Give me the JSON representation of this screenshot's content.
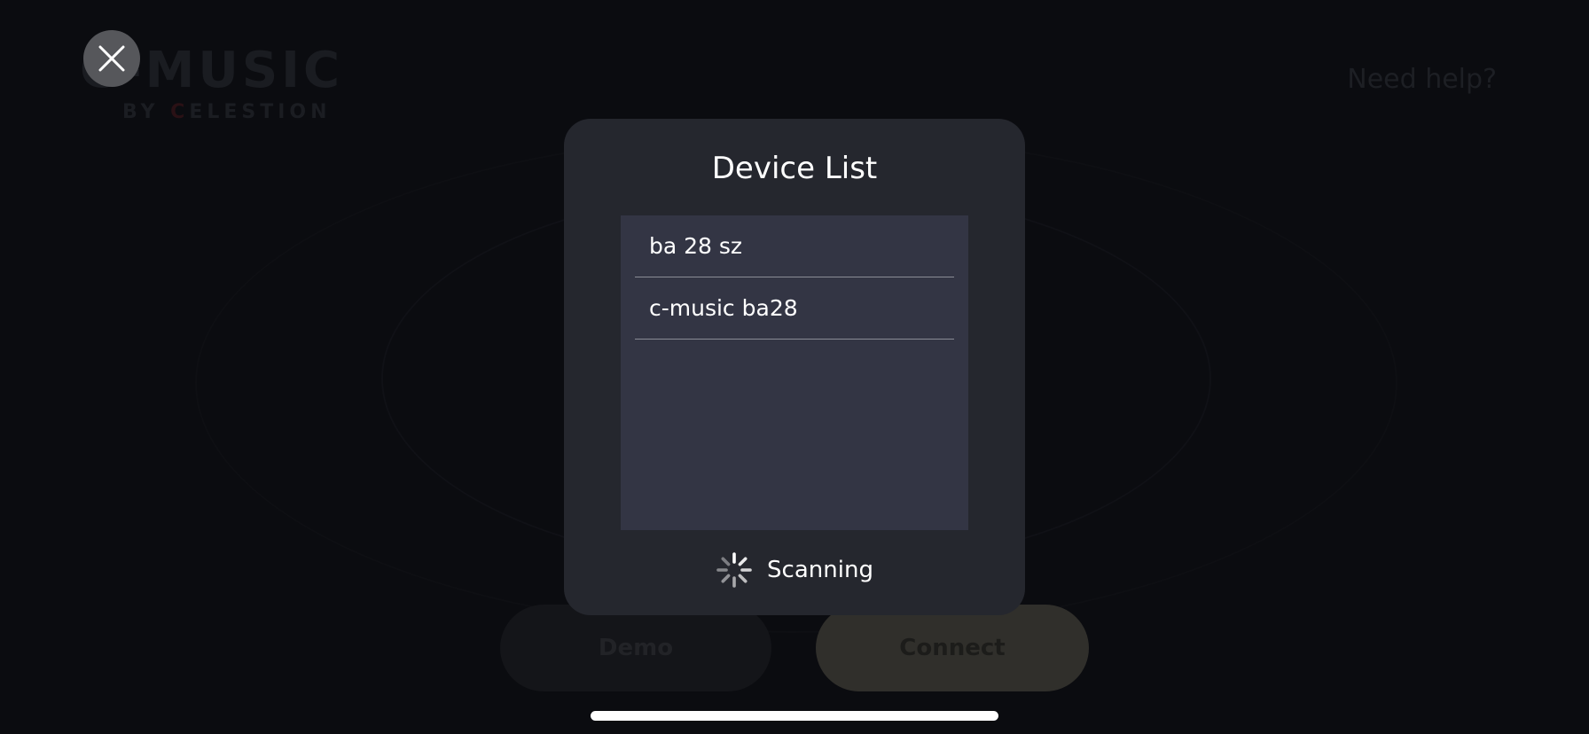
{
  "background": {
    "logo_main": "C-MUSIC",
    "logo_sub_prefix": "BY ",
    "logo_sub_accent": "C",
    "logo_sub_rest": "ELESTION",
    "help_link": "Need help?",
    "demo_button": "Demo",
    "connect_button": "Connect"
  },
  "close_button": {
    "icon": "close-icon"
  },
  "modal": {
    "title": "Device List",
    "devices": [
      {
        "name": "ba 28 sz"
      },
      {
        "name": "c-music ba28"
      }
    ],
    "status": "Scanning",
    "status_icon": "spinner-icon"
  },
  "colors": {
    "background": "#0b0c10",
    "modal_bg": "#25272e",
    "list_bg": "#333544",
    "close_bg": "#56575b",
    "text": "#ffffff"
  }
}
